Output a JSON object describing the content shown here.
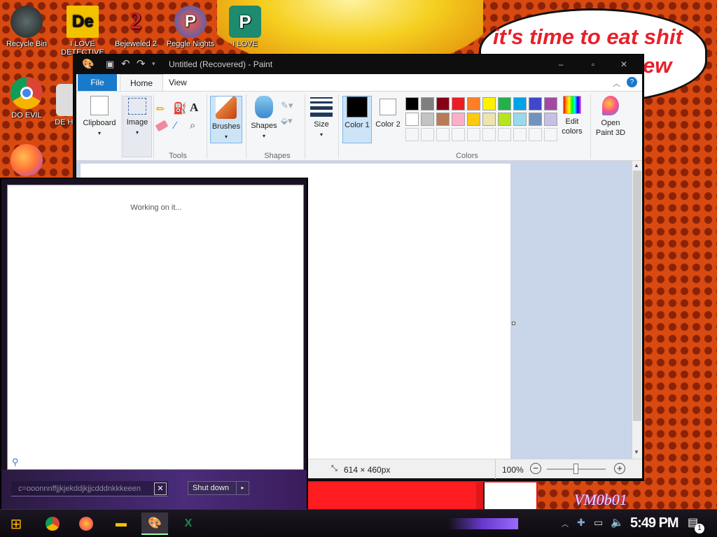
{
  "wallpaper": {
    "bubble_line1": "it's time to eat shit",
    "bubble_line2": "ew",
    "signature": "VM0b01"
  },
  "desktop": {
    "icons": [
      {
        "label": "Recycle Bin",
        "icon": "recycle-bin-icon"
      },
      {
        "label": "I LOVE DETECTIVE",
        "icon": "app-icon"
      },
      {
        "label": "Bejeweled 2",
        "icon": "bejeweled-icon"
      },
      {
        "label": "Peggle Nights",
        "icon": "peggle-icon"
      },
      {
        "label": "I LOVE",
        "icon": "publisher-icon"
      },
      {
        "label": "DO EVIL",
        "icon": "chrome-icon"
      },
      {
        "label": "DE HA",
        "icon": "app-icon"
      }
    ]
  },
  "paint": {
    "title": "Untitled (Recovered) - Paint",
    "tabs": {
      "file": "File",
      "home": "Home",
      "view": "View"
    },
    "groups": {
      "clipboard": "Clipboard",
      "image": "Image",
      "tools": "Tools",
      "brushes": "Brushes",
      "shapes_btn": "Shapes",
      "shapes": "Shapes",
      "size": "Size",
      "color1": "Color 1",
      "color2": "Color 2",
      "colors": "Colors",
      "edit_colors": "Edit colors",
      "open_paint3d": "Open Paint 3D"
    },
    "palette_row1": [
      "#000000",
      "#7f7f7f",
      "#880015",
      "#ed1c24",
      "#ff7f27",
      "#fff200",
      "#22b14c",
      "#00a2e8",
      "#3f48cc",
      "#a349a4"
    ],
    "palette_row2": [
      "#ffffff",
      "#c3c3c3",
      "#b97a57",
      "#ffaec9",
      "#ffc90e",
      "#efe4b0",
      "#b5e61d",
      "#99d9ea",
      "#7092be",
      "#c8bfe7"
    ],
    "status": {
      "size": "614 × 460px",
      "zoom": "100%"
    },
    "colors": {
      "ribbon_bg": "#f5f6f7",
      "file_tab": "#1979ca",
      "color1": "#000000",
      "color2": "#ffffff"
    }
  },
  "overlay": {
    "working": "Working on it...",
    "search_value": "c=ooonnnffjjkjekddjkjjcdddnkkkeeen",
    "shutdown": "Shut down"
  },
  "taskbar": {
    "clock": "5:49 PM",
    "notification_count": "1"
  }
}
